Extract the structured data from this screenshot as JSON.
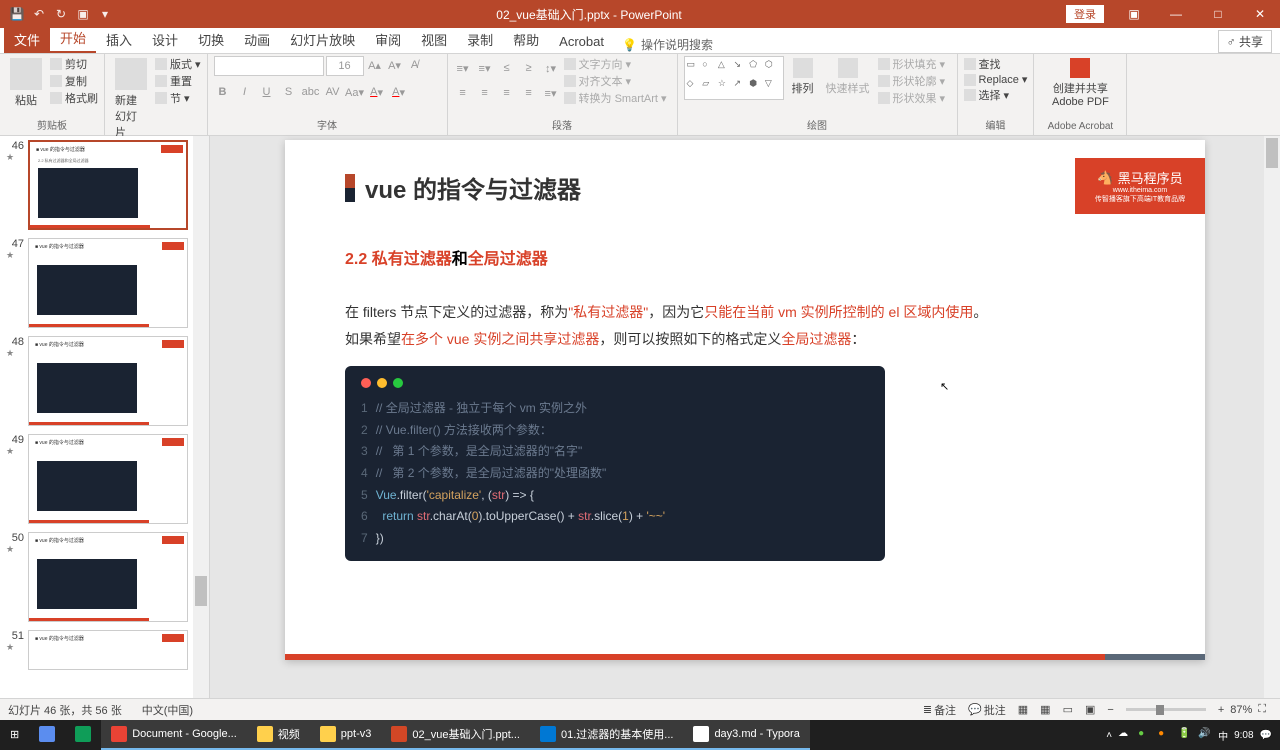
{
  "titlebar": {
    "filename": "02_vue基础入门.pptx - PowerPoint",
    "login": "登录"
  },
  "tabs": {
    "file": "文件",
    "home": "开始",
    "insert": "插入",
    "design": "设计",
    "transitions": "切换",
    "animations": "动画",
    "slideshow": "幻灯片放映",
    "review": "审阅",
    "view": "视图",
    "recording": "录制",
    "help": "帮助",
    "acrobat": "Acrobat",
    "search": "操作说明搜索",
    "share": "共享"
  },
  "ribbon": {
    "clipboard": {
      "label": "剪贴板",
      "paste": "粘贴",
      "cut": "剪切",
      "copy": "复制",
      "format_painter": "格式刷"
    },
    "slides": {
      "label": "幻灯片",
      "new_slide": "新建\n幻灯片",
      "layout": "版式",
      "reset": "重置",
      "section": "节"
    },
    "font": {
      "label": "字体",
      "size": "16"
    },
    "paragraph": {
      "label": "段落",
      "direction": "文字方向",
      "align": "对齐文本",
      "smartart": "转换为 SmartArt"
    },
    "drawing": {
      "label": "绘图",
      "arrange": "排列",
      "quick_styles": "快速样式",
      "shape_fill": "形状填充",
      "shape_outline": "形状轮廓",
      "shape_effects": "形状效果"
    },
    "editing": {
      "label": "编辑",
      "find": "查找",
      "replace": "Replace",
      "select": "选择"
    },
    "adobe": {
      "label": "Adobe Acrobat",
      "create_share": "创建并共享\nAdobe PDF"
    }
  },
  "thumbs": [
    {
      "num": "46"
    },
    {
      "num": "47"
    },
    {
      "num": "48"
    },
    {
      "num": "49"
    },
    {
      "num": "50"
    },
    {
      "num": "51"
    }
  ],
  "slide": {
    "title": "vue 的指令与过滤器",
    "logo": "黑马程序员",
    "logo_url": "www.itheima.com",
    "logo_sub": "传智播客旗下高端IT教育品牌",
    "subtitle_num": "2.2 ",
    "subtitle_a": "私有过滤器",
    "subtitle_and": "和",
    "subtitle_b": "全局过滤器",
    "body_p1_a": "在 filters 节点下定义的过滤器，称为",
    "body_p1_q1": "\"",
    "body_p1_b": "私有过滤器",
    "body_p1_q2": "\"",
    "body_p1_c": "，因为它",
    "body_p1_d": "只能在当前 vm 实例所控制的 el 区域内使用",
    "body_p1_e": "。",
    "body_p2_a": "如果希望",
    "body_p2_b": "在多个 vue 实例之间共享过滤器",
    "body_p2_c": "，则可以按照如下的格式定义",
    "body_p2_d": "全局过滤器",
    "body_p2_e": "：",
    "code": {
      "l1": "// 全局过滤器 - 独立于每个 vm 实例之外",
      "l2": "// Vue.filter() 方法接收两个参数：",
      "l3": "//   第 1 个参数，是全局过滤器的\"名字\"",
      "l4": "//   第 2 个参数，是全局过滤器的\"处理函数\"",
      "l5_a": "Vue",
      "l5_b": ".filter(",
      "l5_c": "'capitalize'",
      "l5_d": ", (",
      "l5_e": "str",
      "l5_f": ") => {",
      "l6_a": "  return ",
      "l6_b": "str",
      "l6_c": ".charAt(",
      "l6_d": "0",
      "l6_e": ").toUpperCase() + ",
      "l6_f": "str",
      "l6_g": ".slice(",
      "l6_h": "1",
      "l6_i": ") + ",
      "l6_j": "'~~'",
      "l7": "})"
    }
  },
  "statusbar": {
    "slide_info": "幻灯片 46 张，共 56 张",
    "lang": "中文(中国)",
    "notes": "备注",
    "comments": "批注",
    "zoom": "87%"
  },
  "taskbar": {
    "items": [
      "Document - Google...",
      "视频",
      "ppt-v3",
      "02_vue基础入门.ppt...",
      "01.过滤器的基本使用...",
      "day3.md - Typora"
    ],
    "ime": "中",
    "time": "9:08"
  }
}
